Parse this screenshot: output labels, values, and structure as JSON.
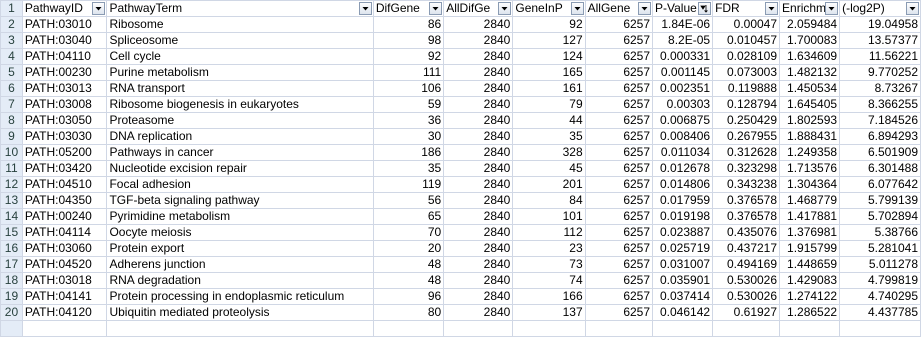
{
  "headers": [
    {
      "label": "PathwayID",
      "filter_icon": "dropdown-arrow-icon"
    },
    {
      "label": "PathwayTerm",
      "filter_icon": "dropdown-arrow-icon"
    },
    {
      "label": "DifGene",
      "filter_icon": "dropdown-arrow-icon"
    },
    {
      "label": "AllDifGe",
      "filter_icon": "dropdown-arrow-icon"
    },
    {
      "label": "GeneInP",
      "filter_icon": "dropdown-arrow-icon"
    },
    {
      "label": "AllGene",
      "filter_icon": "dropdown-arrow-icon"
    },
    {
      "label": "P-Value",
      "filter_icon": "sort-ascending-filter-icon"
    },
    {
      "label": "FDR",
      "filter_icon": "dropdown-arrow-icon"
    },
    {
      "label": "Enrichm",
      "filter_icon": "dropdown-arrow-icon"
    },
    {
      "label": "(-log2P)",
      "filter_icon": "dropdown-arrow-icon"
    }
  ],
  "rows": [
    {
      "n": "2",
      "cells": [
        "PATH:03010",
        "Ribosome",
        "86",
        "2840",
        "92",
        "6257",
        "1.84E-06",
        "0.00047",
        "2.059484",
        "19.04958"
      ]
    },
    {
      "n": "3",
      "cells": [
        "PATH:03040",
        "Spliceosome",
        "98",
        "2840",
        "127",
        "6257",
        "8.2E-05",
        "0.010457",
        "1.700083",
        "13.57377"
      ]
    },
    {
      "n": "4",
      "cells": [
        "PATH:04110",
        "Cell cycle",
        "92",
        "2840",
        "124",
        "6257",
        "0.000331",
        "0.028109",
        "1.634609",
        "11.56221"
      ]
    },
    {
      "n": "5",
      "cells": [
        "PATH:00230",
        "Purine metabolism",
        "111",
        "2840",
        "165",
        "6257",
        "0.001145",
        "0.073003",
        "1.482132",
        "9.770252"
      ]
    },
    {
      "n": "6",
      "cells": [
        "PATH:03013",
        "RNA transport",
        "106",
        "2840",
        "161",
        "6257",
        "0.002351",
        "0.119888",
        "1.450534",
        "8.73267"
      ]
    },
    {
      "n": "7",
      "cells": [
        "PATH:03008",
        "Ribosome biogenesis in eukaryotes",
        "59",
        "2840",
        "79",
        "6257",
        "0.00303",
        "0.128794",
        "1.645405",
        "8.366255"
      ]
    },
    {
      "n": "8",
      "cells": [
        "PATH:03050",
        "Proteasome",
        "36",
        "2840",
        "44",
        "6257",
        "0.006875",
        "0.250429",
        "1.802593",
        "7.184526"
      ]
    },
    {
      "n": "9",
      "cells": [
        "PATH:03030",
        "DNA replication",
        "30",
        "2840",
        "35",
        "6257",
        "0.008406",
        "0.267955",
        "1.888431",
        "6.894293"
      ]
    },
    {
      "n": "10",
      "cells": [
        "PATH:05200",
        "Pathways in cancer",
        "186",
        "2840",
        "328",
        "6257",
        "0.011034",
        "0.312628",
        "1.249358",
        "6.501909"
      ]
    },
    {
      "n": "11",
      "cells": [
        "PATH:03420",
        "Nucleotide excision repair",
        "35",
        "2840",
        "45",
        "6257",
        "0.012678",
        "0.323298",
        "1.713576",
        "6.301488"
      ]
    },
    {
      "n": "12",
      "cells": [
        "PATH:04510",
        "Focal adhesion",
        "119",
        "2840",
        "201",
        "6257",
        "0.014806",
        "0.343238",
        "1.304364",
        "6.077642"
      ]
    },
    {
      "n": "13",
      "cells": [
        "PATH:04350",
        "TGF-beta signaling pathway",
        "56",
        "2840",
        "84",
        "6257",
        "0.017959",
        "0.376578",
        "1.468779",
        "5.799139"
      ]
    },
    {
      "n": "14",
      "cells": [
        "PATH:00240",
        "Pyrimidine metabolism",
        "65",
        "2840",
        "101",
        "6257",
        "0.019198",
        "0.376578",
        "1.417881",
        "5.702894"
      ]
    },
    {
      "n": "15",
      "cells": [
        "PATH:04114",
        "Oocyte meiosis",
        "70",
        "2840",
        "112",
        "6257",
        "0.023887",
        "0.435076",
        "1.376981",
        "5.38766"
      ]
    },
    {
      "n": "16",
      "cells": [
        "PATH:03060",
        "Protein export",
        "20",
        "2840",
        "23",
        "6257",
        "0.025719",
        "0.437217",
        "1.915799",
        "5.281041"
      ]
    },
    {
      "n": "17",
      "cells": [
        "PATH:04520",
        "Adherens junction",
        "48",
        "2840",
        "73",
        "6257",
        "0.031007",
        "0.494169",
        "1.448659",
        "5.011278"
      ]
    },
    {
      "n": "18",
      "cells": [
        "PATH:03018",
        "RNA degradation",
        "48",
        "2840",
        "74",
        "6257",
        "0.035901",
        "0.530026",
        "1.429083",
        "4.799819"
      ]
    },
    {
      "n": "19",
      "cells": [
        "PATH:04141",
        "Protein processing in endoplasmic reticulum",
        "96",
        "2840",
        "166",
        "6257",
        "0.037414",
        "0.530026",
        "1.274122",
        "4.740295"
      ]
    },
    {
      "n": "20",
      "cells": [
        "PATH:04120",
        "Ubiquitin mediated proteolysis",
        "80",
        "2840",
        "137",
        "6257",
        "0.046142",
        "0.61927",
        "1.286522",
        "4.437785"
      ]
    }
  ],
  "header_row_number": "1",
  "colors": {
    "gridline": "#d0d7e5",
    "row_header_bg": "#e4ecf7",
    "row_header_text": "#27413e"
  }
}
